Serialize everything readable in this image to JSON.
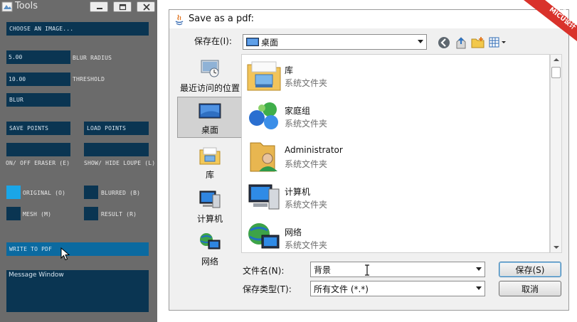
{
  "tools": {
    "title": "Tools",
    "choose_image": "CHOOSE AN IMAGE...",
    "blur_radius_value": "5.00",
    "blur_radius_label": "BLUR RADIUS",
    "threshold_value": "10.00",
    "threshold_label": "THRESHOLD",
    "blur": "BLUR",
    "save_points": "SAVE POINTS",
    "load_points": "LOAD POINTS",
    "eraser_label": "ON/ OFF ERASER (E)",
    "loupe_label": "SHOW/ HIDE LOUPE (L)",
    "original_label": "ORIGINAL (O)",
    "blurred_label": "BLURRED (B)",
    "mesh_label": "MESH (M)",
    "result_label": "RESULT (R)",
    "write_pdf": "WRITE TO PDF",
    "message_window": "Message Window"
  },
  "dialog": {
    "title": "Save as a pdf:",
    "save_in_label": "保存在(I):",
    "save_in_value": "桌面",
    "places": [
      "最近访问的位置",
      "桌面",
      "库",
      "计算机",
      "网络"
    ],
    "files": [
      {
        "name": "库",
        "type": "系统文件夹",
        "icon": "library-folder-icon"
      },
      {
        "name": "家庭组",
        "type": "系统文件夹",
        "icon": "homegroup-icon"
      },
      {
        "name": "Administrator",
        "type": "系统文件夹",
        "icon": "user-folder-icon"
      },
      {
        "name": "计算机",
        "type": "系统文件夹",
        "icon": "computer-icon"
      },
      {
        "name": "网络",
        "type": "系统文件夹",
        "icon": "network-icon"
      }
    ],
    "filename_label": "文件名(N):",
    "filename_value": "背景",
    "filetype_label": "保存类型(T):",
    "filetype_value": "所有文件 (*.*)",
    "save_button": "保存(S)",
    "cancel_button": "取消"
  },
  "ribbon": {
    "line1": "公众号",
    "line2": "MICU设计"
  },
  "colors": {
    "tools_bg": "#6b6b6b",
    "tools_control": "#0a3552",
    "tools_highlight": "#0b6aa0",
    "tools_swatch_on": "#1aa6e8",
    "ribbon": "#d9322b"
  }
}
